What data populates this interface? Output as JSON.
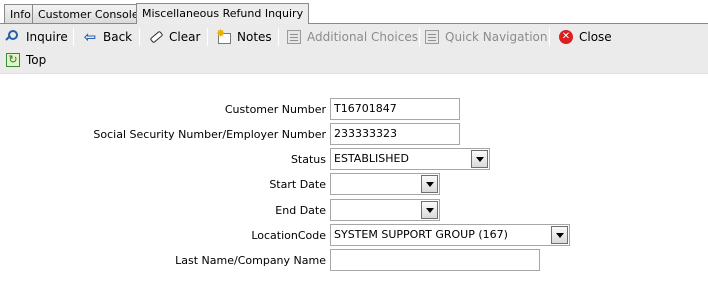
{
  "tabs": [
    {
      "label": "Info"
    },
    {
      "label": "Customer Console"
    },
    {
      "label": "Miscellaneous Refund Inquiry",
      "active": true
    }
  ],
  "toolbar": {
    "inquire": "Inquire",
    "back": "Back",
    "clear": "Clear",
    "notes": "Notes",
    "additional_choices": "Additional Choices",
    "quick_navigation": "Quick Navigation",
    "close": "Close",
    "top": "Top"
  },
  "form": {
    "customer_number": {
      "label": "Customer Number",
      "value": "T16701847"
    },
    "ssn_employer_number": {
      "label": "Social Security Number/Employer Number",
      "value": "233333323"
    },
    "status": {
      "label": "Status",
      "value": "ESTABLISHED"
    },
    "start_date": {
      "label": "Start Date",
      "value": ""
    },
    "end_date": {
      "label": "End Date",
      "value": ""
    },
    "location_code": {
      "label": "LocationCode",
      "value": "SYSTEM SUPPORT GROUP (167)"
    },
    "last_name_company": {
      "label": "Last Name/Company Name",
      "value": ""
    }
  },
  "colors": {
    "toolbar_bg": "#ebebeb",
    "disabled_text": "#8c8c8c",
    "close_icon": "#d91f1f",
    "accent_icon": "#2a5ca8"
  }
}
